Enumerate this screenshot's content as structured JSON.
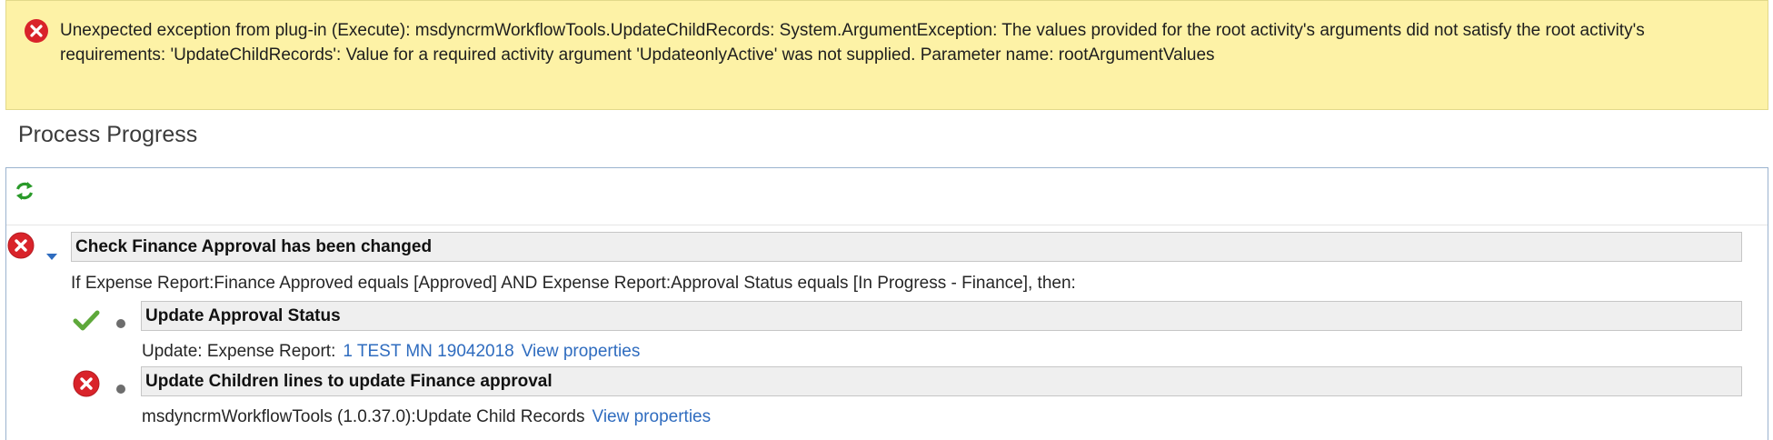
{
  "error_banner": {
    "message": "Unexpected exception from plug-in (Execute): msdyncrmWorkflowTools.UpdateChildRecords: System.ArgumentException: The values provided for the root activity's arguments did not satisfy the root activity's requirements: 'UpdateChildRecords': Value for a required activity argument 'UpdateonlyActive' was not supplied. Parameter name: rootArgumentValues",
    "icon": "error-icon",
    "color": "#fdf2a6"
  },
  "section_title": "Process Progress",
  "toolbar": {
    "refresh_icon": "refresh-icon"
  },
  "steps": [
    {
      "title": "Check Finance Approval has been changed",
      "status": "error",
      "condition": "If Expense Report:Finance Approved equals [Approved] AND Expense Report:Approval Status equals [In Progress - Finance], then:",
      "children": [
        {
          "title": "Update Approval Status",
          "status": "success",
          "prefix": "Update:  Expense Report:",
          "record_link": "1 TEST MN 19042018",
          "properties_link": "View properties"
        },
        {
          "title": "Update Children lines to update Finance approval",
          "status": "error",
          "prefix": "msdyncrmWorkflowTools (1.0.37.0):Update Child Records",
          "properties_link": "View properties"
        }
      ]
    }
  ],
  "colors": {
    "error": "#d9232a",
    "success": "#5ea83a",
    "link": "#2f6cbf"
  }
}
